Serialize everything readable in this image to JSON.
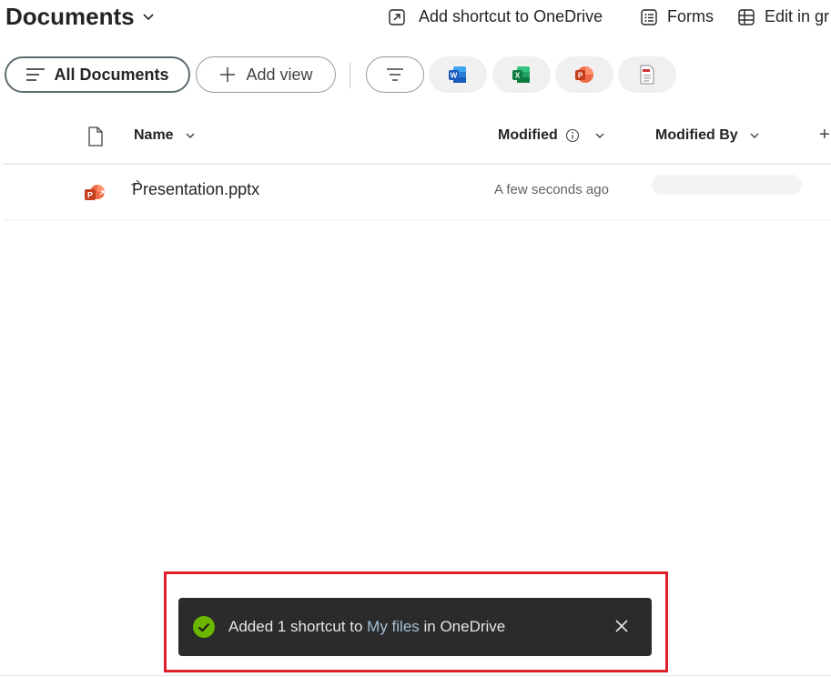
{
  "header": {
    "title": "Documents",
    "commands": {
      "add_shortcut": "Add shortcut to OneDrive",
      "forms": "Forms",
      "edit_grid": "Edit in gr"
    }
  },
  "views": {
    "selected": "All Documents",
    "add_view": "Add view"
  },
  "columns": {
    "name": "Name",
    "modified": "Modified",
    "modified_by": "Modified By",
    "add": "+"
  },
  "files": [
    {
      "name": "Presentation.pptx",
      "modified": "A few seconds ago",
      "modified_by": ""
    }
  ],
  "toast": {
    "prefix": "Added 1 shortcut to ",
    "link": "My files",
    "suffix": " in OneDrive"
  },
  "colors": {
    "success": "#6bb700",
    "highlight_border": "#e0202a",
    "toast_bg": "#2b2b2b",
    "word": "#185abd",
    "excel": "#107c41",
    "powerpoint": "#c43e1c",
    "pdf": "#d13438"
  }
}
